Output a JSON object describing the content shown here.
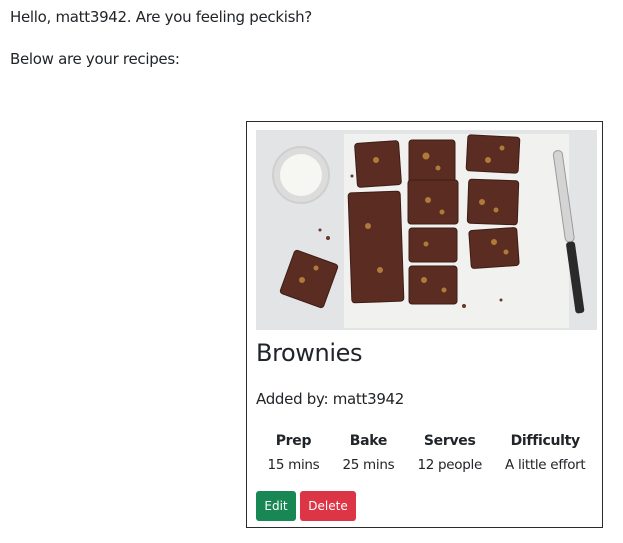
{
  "greeting": "Hello, matt3942. Are you feeling peckish?",
  "intro": "Below are your recipes:",
  "recipe": {
    "image_alt": "brownies-photo",
    "title": "Brownies",
    "added_by_label": "Added by: ",
    "added_by_user": "matt3942",
    "stats": [
      {
        "label": "Prep",
        "value": "15 mins"
      },
      {
        "label": "Bake",
        "value": "25 mins"
      },
      {
        "label": "Serves",
        "value": "12 people"
      },
      {
        "label": "Difficulty",
        "value": "A little effort"
      }
    ],
    "edit_label": "Edit",
    "delete_label": "Delete"
  },
  "colors": {
    "edit": "#198754",
    "delete": "#dc3545",
    "card_border": "#2b2b2b"
  }
}
